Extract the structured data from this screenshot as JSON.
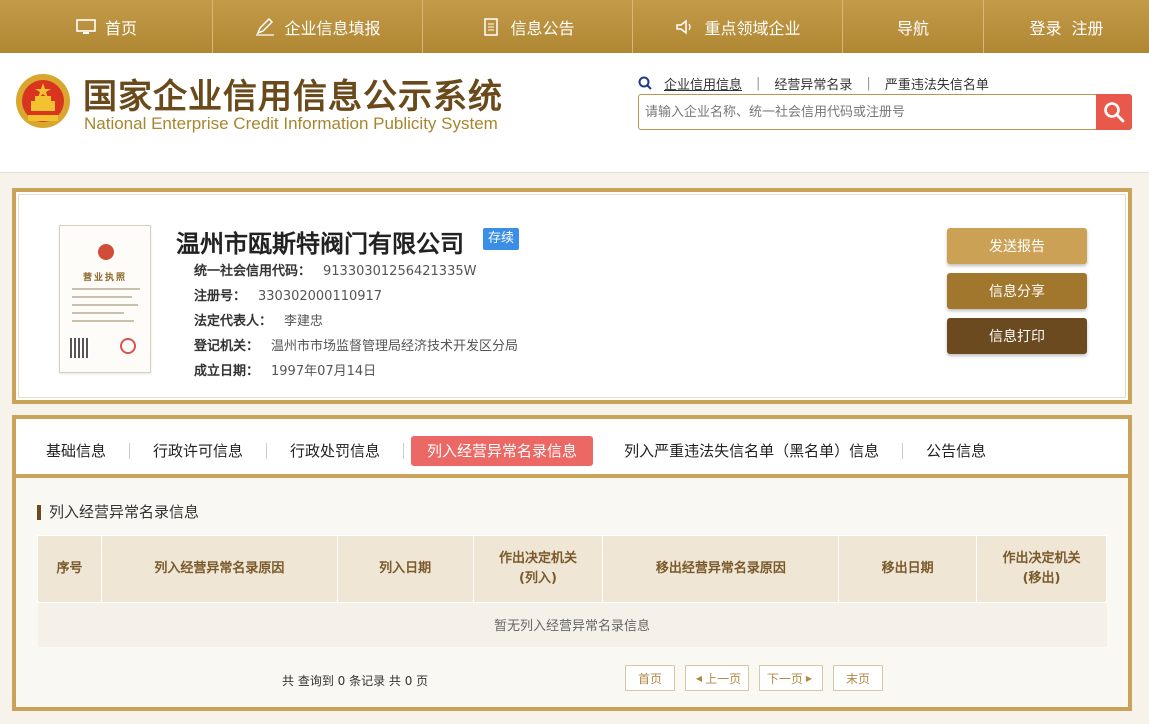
{
  "topnav": {
    "home": "首页",
    "fill": "企业信息填报",
    "notice": "信息公告",
    "key": "重点领域企业",
    "guide": "导航",
    "login": "登录",
    "register": "注册"
  },
  "header": {
    "title_cn": "国家企业信用信息公示系统",
    "title_en": "National Enterprise Credit Information Publicity System",
    "search_tabs": [
      "企业信用信息",
      "经营异常名录",
      "严重违法失信名单"
    ],
    "search_placeholder": "请输入企业名称、统一社会信用代码或注册号"
  },
  "company": {
    "name": "温州市瓯斯特阀门有限公司",
    "status": "存续",
    "license_title": "营业执照",
    "fields": [
      {
        "label": "统一社会信用代码：",
        "value": "91330301256421335W"
      },
      {
        "label": "注册号：",
        "value": "330302000110917"
      },
      {
        "label": "法定代表人：",
        "value": "李建忠"
      },
      {
        "label": "登记机关：",
        "value": "温州市市场监督管理局经济技术开发区分局"
      },
      {
        "label": "成立日期：",
        "value": "1997年07月14日"
      }
    ],
    "actions": {
      "report": "发送报告",
      "share": "信息分享",
      "print": "信息打印"
    }
  },
  "detail": {
    "tabs": [
      "基础信息",
      "行政许可信息",
      "行政处罚信息",
      "列入经营异常名录信息",
      "列入严重违法失信名单（黑名单）信息",
      "公告信息"
    ],
    "active_tab": 3,
    "section_title": "列入经营异常名录信息",
    "columns": [
      "序号",
      "列入经营异常名录原因",
      "列入日期",
      "作出决定机关\n(列入)",
      "移出经营异常名录原因",
      "移出日期",
      "作出决定机关\n(移出)"
    ],
    "empty_text": "暂无列入经营异常名录信息",
    "summary": "共 查询到 0 条记录 共 0 页",
    "pager": {
      "first": "首页",
      "prev": "上一页",
      "next": "下一页",
      "last": "末页"
    }
  },
  "colors": {
    "brand_gold": "#c39a48",
    "accent_red": "#ec6865",
    "status_blue": "#3a8ee6",
    "dark_brown": "#6a4a1e"
  }
}
